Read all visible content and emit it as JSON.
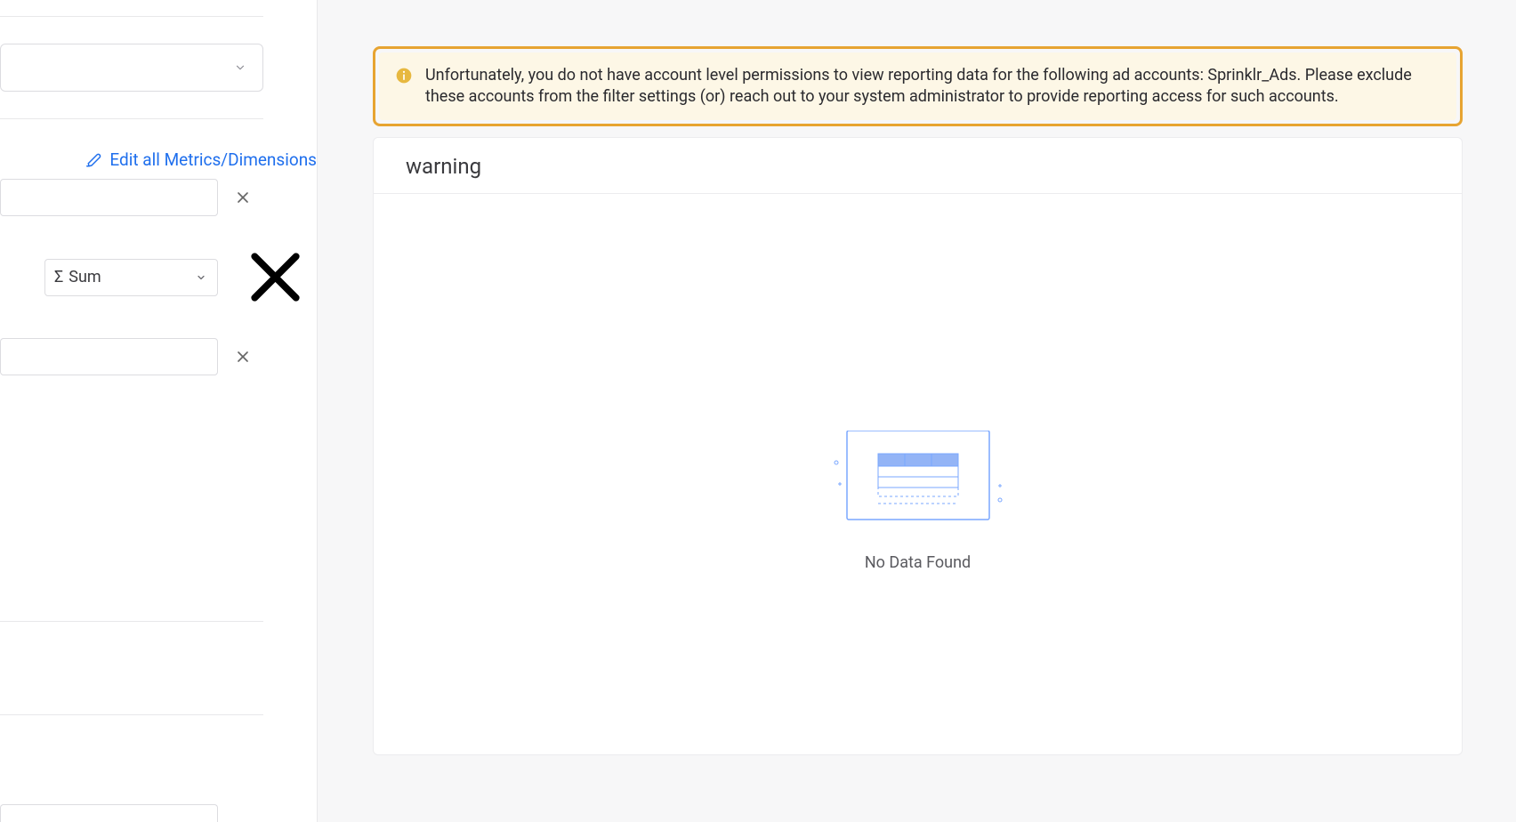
{
  "sidebar": {
    "edit_link_label": "Edit all Metrics/Dimensions",
    "aggregation_sigma": "Σ",
    "aggregation_label": "Sum"
  },
  "banner": {
    "message": "Unfortunately, you do not have account level permissions to view reporting data for the following ad accounts: Sprinklr_Ads. Please exclude these accounts from the filter settings (or) reach out to your system administrator to provide reporting access for such accounts."
  },
  "card": {
    "title": "warning",
    "empty_message": "No Data Found"
  },
  "colors": {
    "warning_border": "#e7a432",
    "warning_bg": "#fdf7e6",
    "link": "#1f6fed",
    "illustration_stroke": "#7aa7ff",
    "illustration_fill": "#93b4f6"
  }
}
